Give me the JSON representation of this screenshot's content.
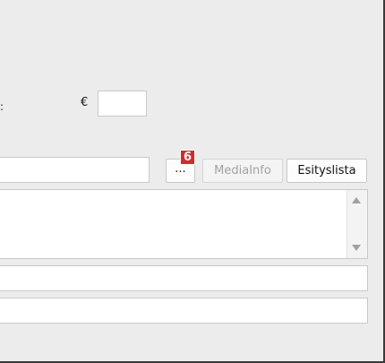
{
  "form": {
    "partial_label": ":",
    "currency_symbol": "€",
    "price_value": "",
    "path_value": ""
  },
  "buttons": {
    "browse_label": "...",
    "mediainfo_label": "MediaInfo",
    "playlist_label": "Esityslista"
  },
  "annotation": {
    "badge_number": "6",
    "badge_color": "#d42a2a"
  },
  "description_text": "",
  "field1_value": "",
  "field2_value": ""
}
